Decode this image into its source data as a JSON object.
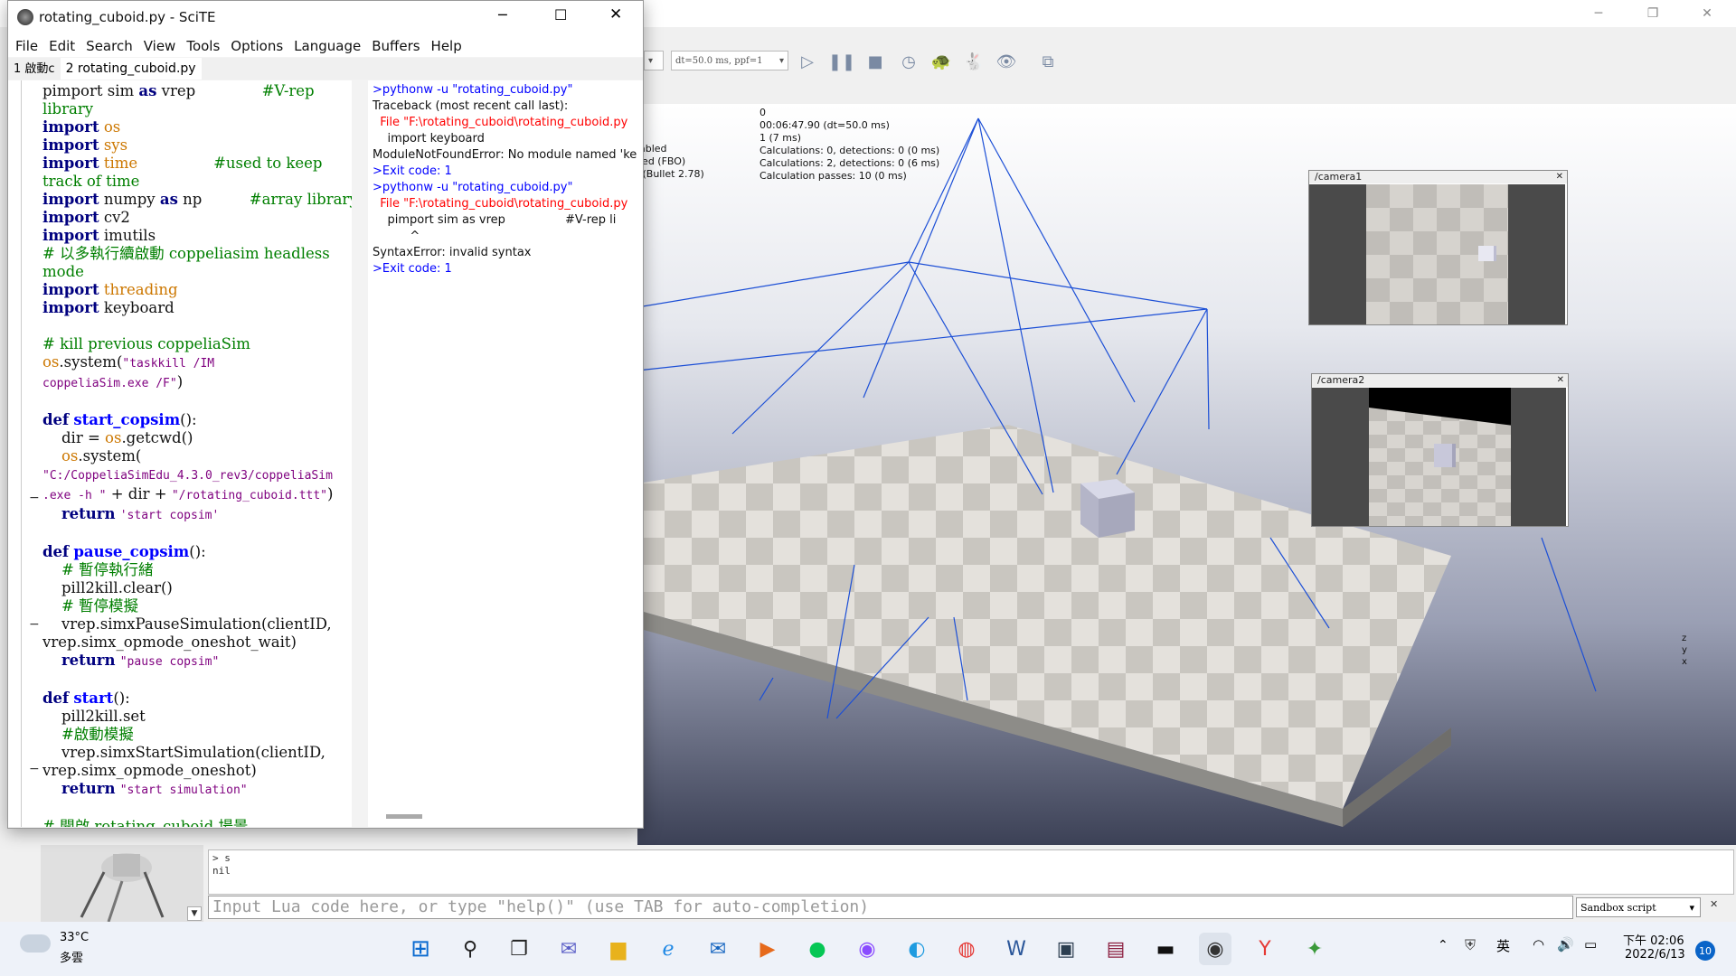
{
  "coppelia": {
    "toolbar": {
      "dt_dropdown": "dt=50.0 ms, ppf=1"
    },
    "info_left": "abled\nled (FBO)\n (Bullet 2.78)",
    "info_right": "0\n00:06:47.90 (dt=50.0 ms)\n1 (7 ms)\nCalculations: 0, detections: 0 (0 ms)\nCalculations: 2, detections: 0 (6 ms)\nCalculation passes: 10 (0 ms)",
    "camera1_title": "/camera1",
    "camera2_title": "/camera2",
    "axes_label": "z\ny\nx",
    "lua_output": "> s\nnil",
    "lua_placeholder": "Input Lua code here, or type \"help()\" (use TAB for auto-completion)",
    "sandbox_label": "Sandbox script"
  },
  "scite": {
    "title": "rotating_cuboid.py - SciTE",
    "menu": [
      "File",
      "Edit",
      "Search",
      "View",
      "Tools",
      "Options",
      "Language",
      "Buffers",
      "Help"
    ],
    "tabs": [
      "1 啟動c",
      "2 rotating_cuboid.py"
    ],
    "output_lines": [
      {
        "text": ">pythonw -u \"rotating_cuboid.py\"",
        "color": "#0000ff"
      },
      {
        "text": "Traceback (most recent call last):",
        "color": "#111111"
      },
      {
        "text": "  File \"F:\\rotating_cuboid\\rotating_cuboid.py",
        "color": "#ff0000"
      },
      {
        "text": "    import keyboard",
        "color": "#111111"
      },
      {
        "text": "ModuleNotFoundError: No module named 'ke",
        "color": "#111111"
      },
      {
        "text": ">Exit code: 1",
        "color": "#0000ff"
      },
      {
        "text": ">pythonw -u \"rotating_cuboid.py\"",
        "color": "#0000ff"
      },
      {
        "text": "  File \"F:\\rotating_cuboid\\rotating_cuboid.py",
        "color": "#ff0000"
      },
      {
        "text": "    pimport sim as vrep                #V-rep li",
        "color": "#111111"
      },
      {
        "text": "          ^",
        "color": "#111111"
      },
      {
        "text": "SyntaxError: invalid syntax",
        "color": "#111111"
      },
      {
        "text": ">Exit code: 1",
        "color": "#0000ff"
      }
    ]
  },
  "taskbar": {
    "weather_temp": "33°C",
    "weather_desc": "多雲",
    "ime": "英",
    "time": "下午 02:06",
    "date": "2022/6/13",
    "notifications": "10"
  }
}
